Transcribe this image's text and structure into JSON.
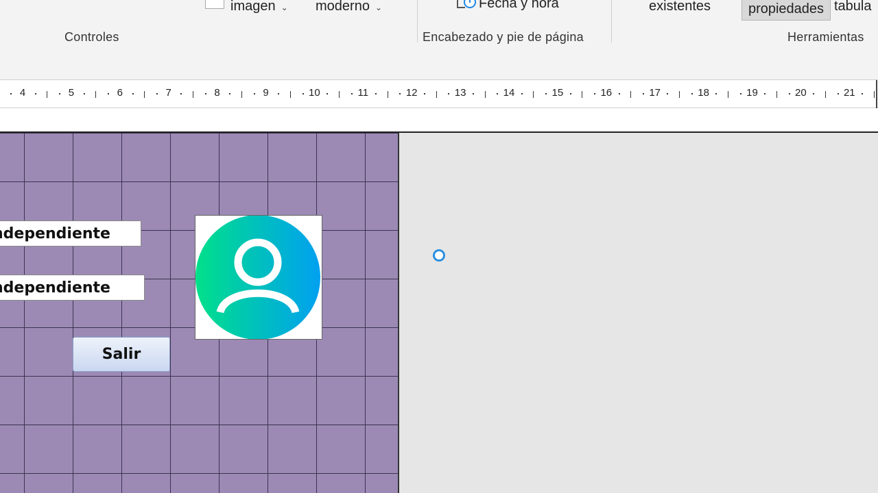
{
  "ribbon": {
    "items": {
      "imagen": "imagen",
      "moderno": "moderno",
      "fecha_hora": "Fecha y hora",
      "existentes": "existentes",
      "propiedades": "propiedades",
      "tabula": "tabula"
    },
    "groups": {
      "controles": "Controles",
      "encabezado": "Encabezado y pie de página",
      "herramientas": "Herramientas"
    }
  },
  "ruler": {
    "numbers": [
      "4",
      "5",
      "6",
      "7",
      "8",
      "9",
      "10",
      "11",
      "12",
      "13",
      "14",
      "15",
      "16",
      "17",
      "18",
      "19",
      "20",
      "21"
    ]
  },
  "form": {
    "textbox1": "ndependiente",
    "textbox2": "ndependiente",
    "exit_button": "Salir"
  },
  "colors": {
    "form_background": "#9c8ab5",
    "avatar_gradient_start": "#00e08a",
    "avatar_gradient_end": "#00a0f0",
    "cursor_ring": "#2b8fe0"
  }
}
